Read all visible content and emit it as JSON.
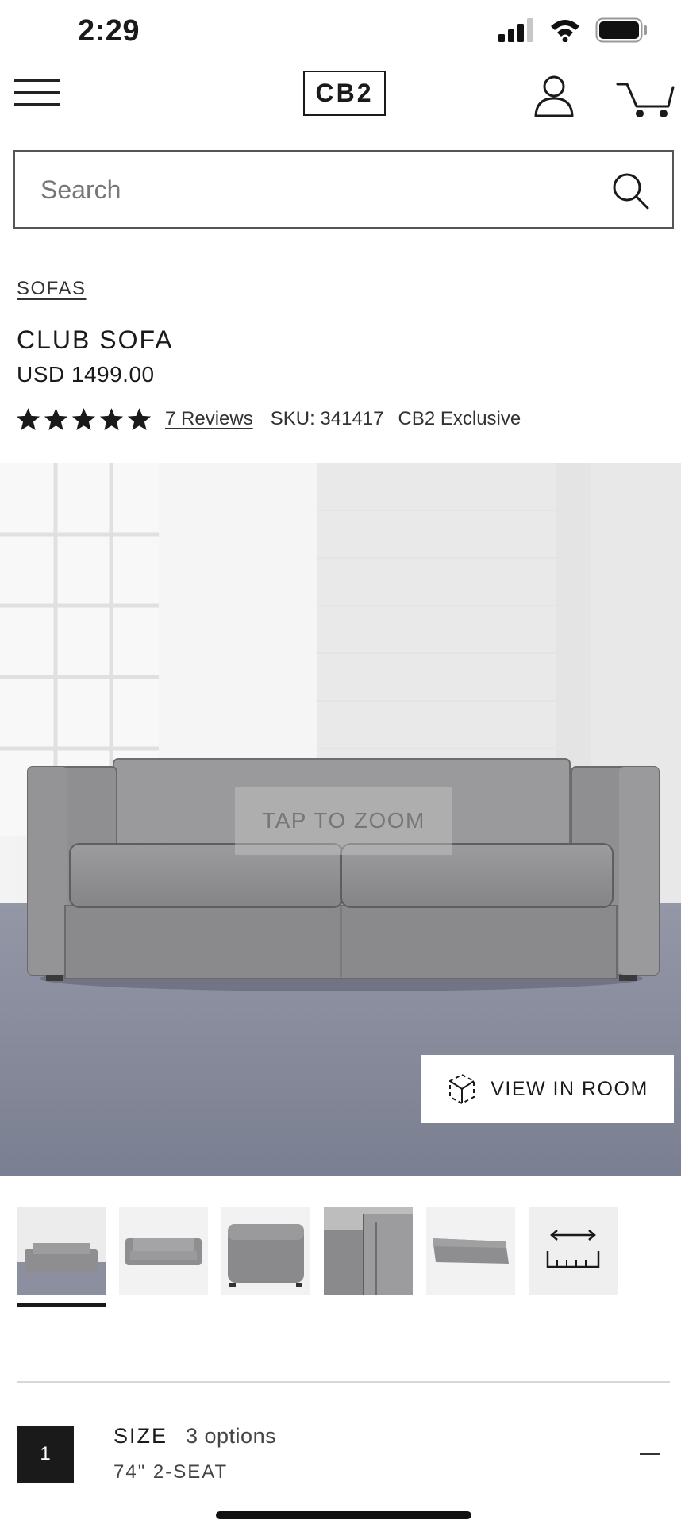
{
  "status_bar": {
    "time": "2:29"
  },
  "header": {
    "logo": "CB2"
  },
  "search": {
    "placeholder": "Search"
  },
  "product": {
    "breadcrumb": "SOFAS",
    "title": "CLUB SOFA",
    "price": "USD 1499.00",
    "rating": 5,
    "rating_max": 5,
    "reviews_label": "7 Reviews",
    "sku": "SKU: 341417",
    "exclusive": "CB2 Exclusive"
  },
  "hero": {
    "zoom_label": "TAP TO ZOOM",
    "view_in_room_label": "VIEW IN ROOM"
  },
  "thumbnails": [
    {
      "name": "front-room-view",
      "selected": true
    },
    {
      "name": "front-view",
      "selected": false
    },
    {
      "name": "side-view",
      "selected": false
    },
    {
      "name": "arm-detail",
      "selected": false
    },
    {
      "name": "angle-view",
      "selected": false
    },
    {
      "name": "dimensions-icon",
      "selected": false
    }
  ],
  "options": {
    "size": {
      "step": "1",
      "label": "SIZE",
      "count_label": "3 options",
      "selected": "74\" 2-SEAT"
    }
  },
  "colors": {
    "text": "#1a1a1a",
    "sofa": "#8a8a8c",
    "floor": "#7c8193",
    "wall": "#ececec"
  }
}
